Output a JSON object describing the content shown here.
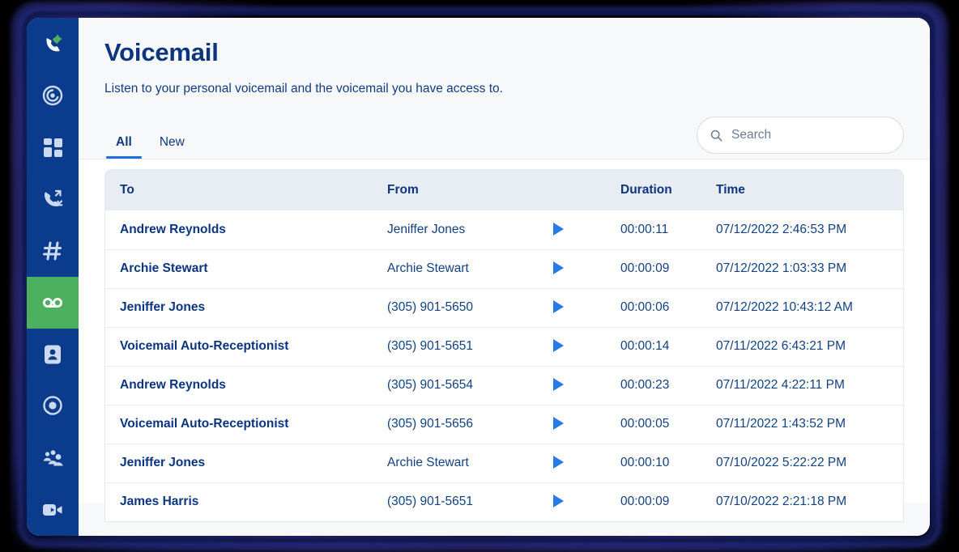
{
  "window": {
    "accent_blue": "#0a3b8c",
    "accent_green": "#4cb05e",
    "accent_link": "#1d6fe0"
  },
  "sidebar": {
    "logo_icon": "nextiva-phone-logo",
    "items": [
      {
        "icon": "call-history-icon",
        "name": "history",
        "active": false
      },
      {
        "icon": "dashboard-grid-icon",
        "name": "dashboard",
        "active": false
      },
      {
        "icon": "call-transfer-icon",
        "name": "calls",
        "active": false
      },
      {
        "icon": "hash-keypad-icon",
        "name": "rooms",
        "active": false
      },
      {
        "icon": "voicemail-icon",
        "name": "voicemail",
        "active": true
      },
      {
        "icon": "contact-card-icon",
        "name": "contacts",
        "active": false
      },
      {
        "icon": "headset-icon",
        "name": "support",
        "active": false
      },
      {
        "icon": "people-group-icon",
        "name": "teams",
        "active": false
      },
      {
        "icon": "video-camera-icon",
        "name": "video",
        "active": false
      }
    ]
  },
  "header": {
    "title": "Voicemail",
    "subtitle": "Listen to your personal voicemail and the voicemail you have access to."
  },
  "tabs": [
    {
      "label": "All",
      "active": true
    },
    {
      "label": "New",
      "active": false
    }
  ],
  "search": {
    "placeholder": "Search",
    "value": "",
    "icon": "search-icon"
  },
  "table": {
    "columns": [
      "To",
      "From",
      "",
      "Duration",
      "Time"
    ],
    "play_icon": "play-icon",
    "rows": [
      {
        "to": "Andrew Reynolds",
        "from": "Jeniffer Jones",
        "duration": "00:00:11",
        "time": "07/12/2022 2:46:53 PM"
      },
      {
        "to": "Archie Stewart",
        "from": "Archie Stewart",
        "duration": "00:00:09",
        "time": "07/12/2022 1:03:33 PM"
      },
      {
        "to": "Jeniffer Jones",
        "from": "(305) 901-5650",
        "duration": "00:00:06",
        "time": "07/12/2022 10:43:12 AM"
      },
      {
        "to": "Voicemail Auto-Receptionist",
        "from": "(305) 901-5651",
        "duration": "00:00:14",
        "time": "07/11/2022 6:43:21 PM"
      },
      {
        "to": "Andrew Reynolds",
        "from": "(305) 901-5654",
        "duration": "00:00:23",
        "time": "07/11/2022 4:22:11 PM"
      },
      {
        "to": "Voicemail Auto-Receptionist",
        "from": "(305) 901-5656",
        "duration": "00:00:05",
        "time": "07/11/2022 1:43:52 PM"
      },
      {
        "to": "Jeniffer Jones",
        "from": "Archie Stewart",
        "duration": "00:00:10",
        "time": "07/10/2022 5:22:22 PM"
      },
      {
        "to": "James Harris",
        "from": "(305) 901-5651",
        "duration": "00:00:09",
        "time": "07/10/2022 2:21:18 PM"
      }
    ]
  }
}
